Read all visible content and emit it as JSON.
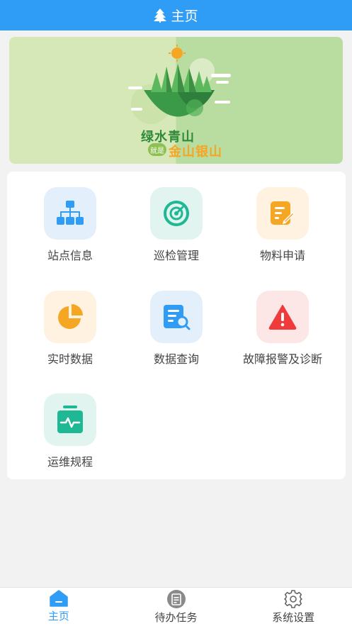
{
  "header": {
    "title": "主页",
    "icon": "tree-icon"
  },
  "banner": {
    "line1": "绿水青山",
    "tag": "就是",
    "line2": "金山银山"
  },
  "grid": {
    "items": [
      {
        "label": "站点信息",
        "icon": "sitemap-icon",
        "bg": "#e3f0fc",
        "color": "#2f9cf6"
      },
      {
        "label": "巡检管理",
        "icon": "radar-icon",
        "bg": "#e1f4ef",
        "color": "#1fb894"
      },
      {
        "label": "物料申请",
        "icon": "edit-document-icon",
        "bg": "#fff2e0",
        "color": "#f5a623"
      },
      {
        "label": "实时数据",
        "icon": "pie-chart-icon",
        "bg": "#fff2e0",
        "color": "#f5a623"
      },
      {
        "label": "数据查询",
        "icon": "document-search-icon",
        "bg": "#e3f0fc",
        "color": "#2f9cf6"
      },
      {
        "label": "故障报警及诊断",
        "icon": "warning-icon",
        "bg": "#fde6e6",
        "color": "#ef3b3b"
      },
      {
        "label": "运维规程",
        "icon": "pulse-case-icon",
        "bg": "#e1f4ef",
        "color": "#1fb894"
      }
    ]
  },
  "tabbar": {
    "tabs": [
      {
        "label": "主页",
        "icon": "home-icon",
        "active": true
      },
      {
        "label": "待办任务",
        "icon": "task-list-icon",
        "active": false
      },
      {
        "label": "系统设置",
        "icon": "gear-icon",
        "active": false
      }
    ]
  },
  "colors": {
    "primary": "#2f9cf6",
    "background": "#f2f2f2"
  }
}
